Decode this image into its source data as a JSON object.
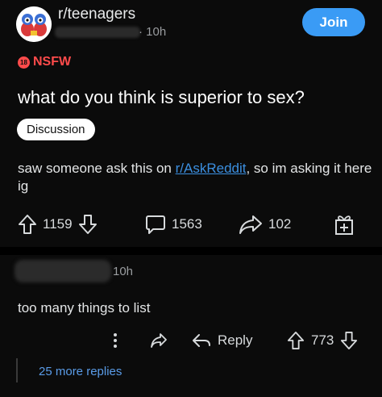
{
  "post": {
    "subreddit": "r/teenagers",
    "time": "10h",
    "join_label": "Join",
    "nsfw_badge": "18",
    "nsfw_label": "NSFW",
    "title": "what do you think is superior to sex?",
    "flair": "Discussion",
    "body_prefix": "saw someone ask this on ",
    "body_link": "r/AskReddit",
    "body_suffix": ", so im asking it here ig",
    "upvotes": "1159",
    "comments": "1563",
    "shares": "102"
  },
  "comment": {
    "time": "10h",
    "text": "too many things to list",
    "reply_label": "Reply",
    "upvotes": "773",
    "more_replies": "25 more replies"
  },
  "colors": {
    "background": "#000000",
    "card": "#0b0b0b",
    "join_button": "#3a9bf5",
    "nsfw": "#ff4b4b",
    "link": "#3b8fe0"
  },
  "icons": {
    "avatar": "subreddit-avatar",
    "upvote": "arrow-up-icon",
    "downvote": "arrow-down-icon",
    "comment": "comment-bubble-icon",
    "share": "share-arrow-icon",
    "award": "gift-award-icon",
    "more": "more-vertical-icon",
    "reply": "reply-arrow-icon"
  }
}
